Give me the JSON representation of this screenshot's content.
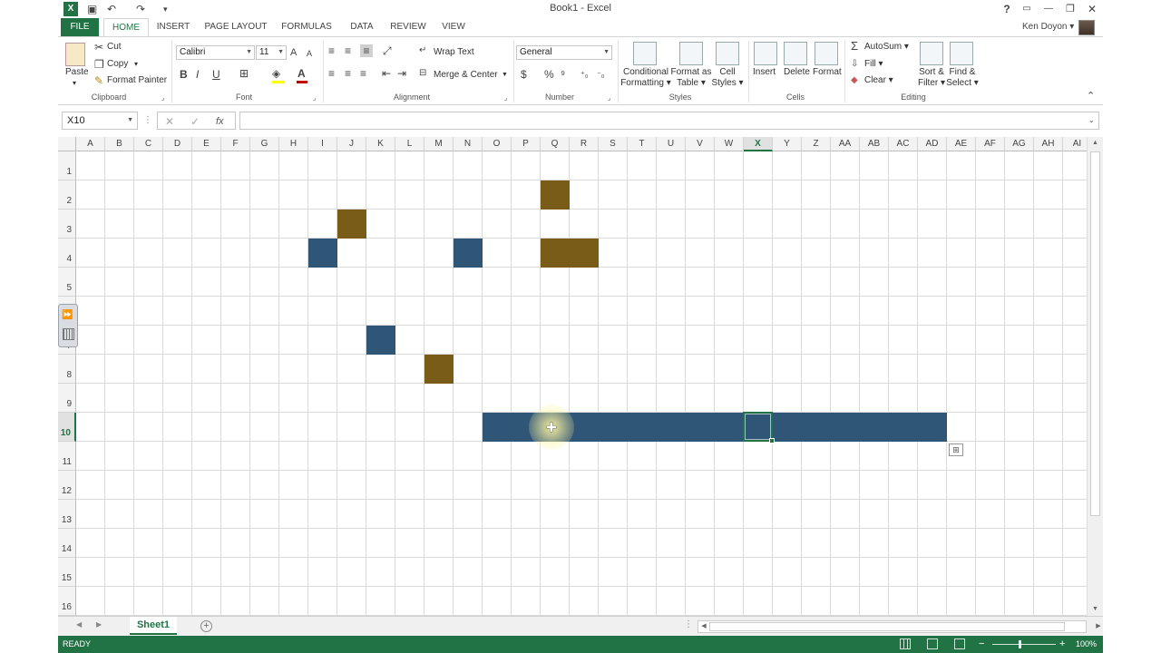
{
  "window": {
    "title": "Book1 - Excel",
    "app_icon": "X",
    "help_glyph": "?",
    "restore_glyph": "▭",
    "minimize_glyph": "—",
    "maximize_glyph": "❐",
    "close_glyph": "✕"
  },
  "quick_access": {
    "save_glyph": "▣",
    "undo_glyph": "↶",
    "redo_glyph": "↷",
    "customize_glyph": "▾"
  },
  "tabs": [
    "FILE",
    "HOME",
    "INSERT",
    "PAGE LAYOUT",
    "FORMULAS",
    "DATA",
    "REVIEW",
    "VIEW"
  ],
  "active_tab": "HOME",
  "user": {
    "name": "Ken Doyon ▾"
  },
  "ribbon": {
    "clipboard": {
      "paste": "Paste",
      "paste_dd": "▾",
      "cut": "Cut",
      "copy": "Copy",
      "copy_dd": "▾",
      "format_painter": "Format Painter",
      "label": "Clipboard",
      "cut_glyph": "✂",
      "copy_glyph": "❐",
      "painter_glyph": "✎"
    },
    "font": {
      "family": "Calibri",
      "size": "11",
      "label": "Font",
      "grow": "A",
      "shrink": "A",
      "bold": "B",
      "italic": "I",
      "underline": "U",
      "borders_glyph": "⊞",
      "fill_glyph": "◈",
      "font_color": "A",
      "fill_color": "#ffff00",
      "text_color": "#c00000"
    },
    "alignment": {
      "wrap_text": "Wrap Text",
      "merge_center": "Merge & Center",
      "label": "Alignment"
    },
    "number": {
      "format": "General",
      "label": "Number",
      "currency": "$",
      "percent": "%",
      "comma": "⁹",
      "inc_decimal": "⁺₀",
      "dec_decimal": "⁻₀"
    },
    "styles": {
      "conditional": [
        "Conditional",
        "Formatting ▾"
      ],
      "format_table": [
        "Format as",
        "Table ▾"
      ],
      "cell_styles": [
        "Cell",
        "Styles ▾"
      ],
      "label": "Styles"
    },
    "cells": {
      "insert": "Insert",
      "delete": "Delete",
      "format": "Format",
      "label": "Cells"
    },
    "editing": {
      "autosum": "AutoSum ▾",
      "fill": "Fill ▾",
      "clear": "Clear ▾",
      "sort_filter": [
        "Sort &",
        "Filter ▾"
      ],
      "find_select": [
        "Find &",
        "Select ▾"
      ],
      "label": "Editing",
      "sigma": "Σ"
    },
    "collapse_glyph": "⌃"
  },
  "formula_bar": {
    "name_box": "X10",
    "fx": "fx",
    "cancel": "✕",
    "enter": "✓",
    "value": ""
  },
  "columns": [
    "A",
    "B",
    "C",
    "D",
    "E",
    "F",
    "G",
    "H",
    "I",
    "J",
    "K",
    "L",
    "M",
    "N",
    "O",
    "P",
    "Q",
    "R",
    "S",
    "T",
    "U",
    "V",
    "W",
    "X",
    "Y",
    "Z",
    "AA",
    "AB",
    "AC",
    "AD",
    "AE",
    "AF",
    "AG",
    "AH",
    "AI"
  ],
  "rows": [
    "1",
    "2",
    "3",
    "4",
    "5",
    "6",
    "7",
    "8",
    "9",
    "10",
    "11",
    "12",
    "13",
    "14",
    "15",
    "16"
  ],
  "selected_cell": {
    "col": "X",
    "row": "10"
  },
  "colors": {
    "blue": "#2f5577",
    "gold": "#7a5c19",
    "accent": "#217346"
  },
  "filled_cells": [
    {
      "col": "Q",
      "row": "2",
      "span": 1,
      "color": "gold"
    },
    {
      "col": "J",
      "row": "3",
      "span": 1,
      "color": "gold"
    },
    {
      "col": "I",
      "row": "4",
      "span": 1,
      "color": "blue"
    },
    {
      "col": "N",
      "row": "4",
      "span": 1,
      "color": "blue"
    },
    {
      "col": "Q",
      "row": "4",
      "span": 2,
      "color": "gold"
    },
    {
      "col": "K",
      "row": "7",
      "span": 1,
      "color": "blue"
    },
    {
      "col": "M",
      "row": "8",
      "span": 1,
      "color": "gold"
    },
    {
      "col": "O",
      "row": "10",
      "span": 16,
      "color": "blue"
    }
  ],
  "sheets": [
    {
      "name": "Sheet1",
      "active": true
    }
  ],
  "status": {
    "text": "READY",
    "zoom": "100%"
  }
}
